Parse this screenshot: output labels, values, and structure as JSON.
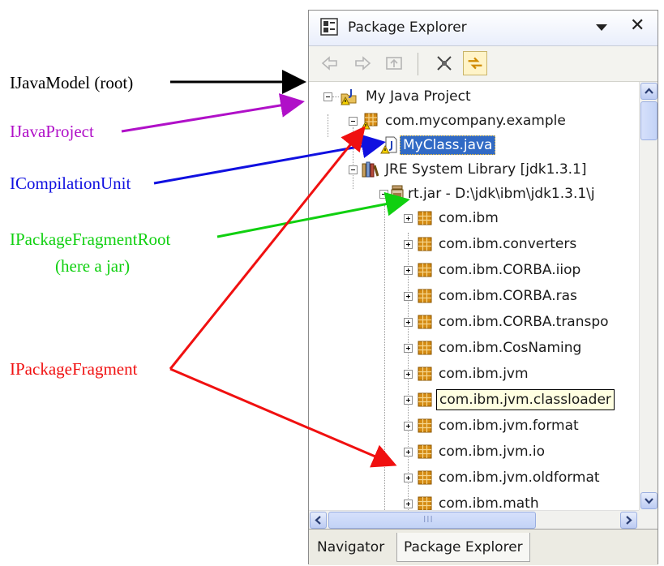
{
  "window": {
    "title": "Package Explorer",
    "close_glyph": "✕"
  },
  "tree": {
    "rows": [
      {
        "label": "My Java Project"
      },
      {
        "label": "com.mycompany.example"
      },
      {
        "label": "MyClass.java"
      },
      {
        "label": "JRE System Library [jdk1.3.1]"
      },
      {
        "label": "rt.jar - D:\\jdk\\ibm\\jdk1.3.1\\j"
      },
      {
        "label": "com.ibm"
      },
      {
        "label": "com.ibm.converters"
      },
      {
        "label": "com.ibm.CORBA.iiop"
      },
      {
        "label": "com.ibm.CORBA.ras"
      },
      {
        "label": "com.ibm.CORBA.transpo"
      },
      {
        "label": "com.ibm.CosNaming"
      },
      {
        "label": "com.ibm.jvm"
      },
      {
        "label": "com.ibm.jvm.classloader"
      },
      {
        "label": "com.ibm.jvm.format"
      },
      {
        "label": "com.ibm.jvm.io"
      },
      {
        "label": "com.ibm.jvm.oldformat"
      },
      {
        "label": "com.ibm.math"
      }
    ]
  },
  "hscroll_grip": "III",
  "tabs": [
    {
      "label": "Navigator"
    },
    {
      "label": "Package Explorer"
    }
  ],
  "annotations": {
    "java_model": {
      "text": "IJavaModel (root)",
      "color": "#000000"
    },
    "java_project": {
      "text": "IJavaProject",
      "color": "#b010c8"
    },
    "compilation_unit": {
      "text": "ICompilationUnit",
      "color": "#1010e0"
    },
    "package_fragment_root": {
      "text": "IPackageFragmentRoot",
      "color": "#10d010"
    },
    "package_fragment_root_note": {
      "text": "(here a jar)",
      "color": "#10d010"
    },
    "package_fragment": {
      "text": "IPackageFragment",
      "color": "#f01010"
    }
  },
  "colors": {
    "selection": "#316ac5",
    "tooltip_bg": "#ffffe1",
    "package_icon": "#c8800c"
  }
}
